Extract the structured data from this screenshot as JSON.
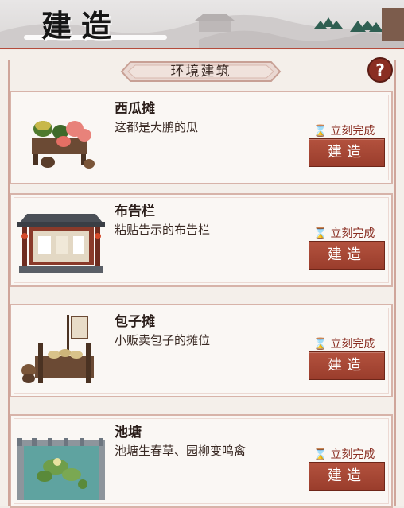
{
  "header": {
    "title": "建造"
  },
  "section": {
    "tab_label": "环境建筑"
  },
  "help": {
    "label": "?"
  },
  "items": [
    {
      "name": "西瓜摊",
      "desc": "这都是大鹏的瓜",
      "status": "立刻完成",
      "button": "建造"
    },
    {
      "name": "布告栏",
      "desc": "粘贴告示的布告栏",
      "status": "立刻完成",
      "button": "建造"
    },
    {
      "name": "包子摊",
      "desc": "小贩卖包子的摊位",
      "status": "立刻完成",
      "button": "建造"
    },
    {
      "name": "池塘",
      "desc": "池塘生春草、园柳变鸣禽",
      "status": "立刻完成",
      "button": "建造"
    }
  ],
  "colors": {
    "accent": "#9a3d2c",
    "status_text": "#8a2e22",
    "border": "#d7b3a9"
  }
}
